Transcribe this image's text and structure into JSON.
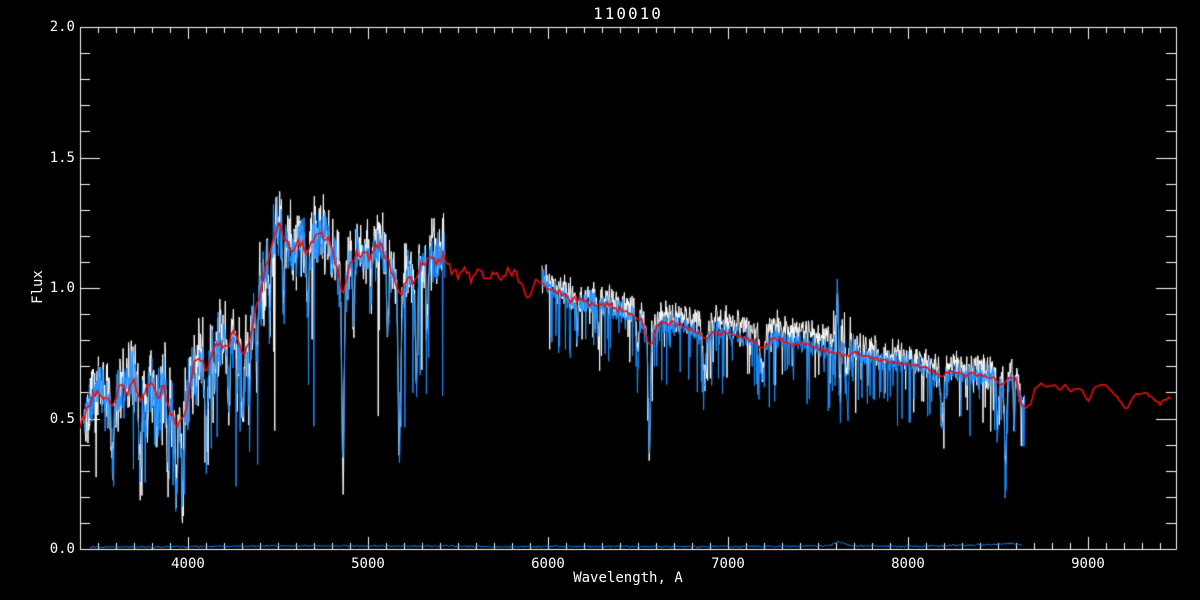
{
  "figure": {
    "background_color": "#000000",
    "axis_color": "#ffffff",
    "text_color": "#ffffff"
  },
  "chart_data": {
    "type": "line",
    "title": "110010",
    "xlabel": "Wavelength, A",
    "ylabel": "Flux",
    "xlim": [
      3400,
      9489
    ],
    "ylim": [
      0.0,
      2.0
    ],
    "xticks": [
      4000,
      5000,
      6000,
      7000,
      8000,
      9000
    ],
    "xtick_labels": [
      "4000",
      "5000",
      "6000",
      "7000",
      "8000",
      "9000"
    ],
    "x_minor_step": 100,
    "yticks": [
      0.0,
      0.5,
      1.0,
      1.5,
      2.0
    ],
    "ytick_labels": [
      "0.0",
      "0.5",
      "1.0",
      "1.5",
      "2.0"
    ],
    "y_minor_step": 0.1,
    "grid": false,
    "legend": null,
    "noise_seed": 1337,
    "series_meta": [
      {
        "name": "observed-spectrum-white",
        "color": "#ffffff",
        "role": "noisy-spectrum"
      },
      {
        "name": "observed-spectrum-blue",
        "color": "#1e90ff",
        "role": "noisy-spectrum"
      },
      {
        "name": "model-spectrum-red",
        "color": "#ee0d0d",
        "role": "model-curve"
      },
      {
        "name": "error-spectrum-blue",
        "color": "#1e90ff",
        "role": "error-near-zero"
      }
    ],
    "segments": [
      [
        3422,
        5428
      ],
      [
        5967,
        8648
      ]
    ],
    "red_range": [
      3400,
      9470
    ],
    "error_range": [
      3455,
      8635
    ],
    "continuum": [
      [
        3400,
        0.48
      ],
      [
        3450,
        0.55
      ],
      [
        3500,
        0.62
      ],
      [
        3540,
        0.57
      ],
      [
        3590,
        0.55
      ],
      [
        3620,
        0.63
      ],
      [
        3660,
        0.6
      ],
      [
        3700,
        0.66
      ],
      [
        3735,
        0.55
      ],
      [
        3770,
        0.63
      ],
      [
        3800,
        0.64
      ],
      [
        3835,
        0.57
      ],
      [
        3865,
        0.62
      ],
      [
        3900,
        0.52
      ],
      [
        3935,
        0.47
      ],
      [
        3970,
        0.5
      ],
      [
        4000,
        0.58
      ],
      [
        4040,
        0.71
      ],
      [
        4070,
        0.74
      ],
      [
        4102,
        0.66
      ],
      [
        4140,
        0.77
      ],
      [
        4180,
        0.8
      ],
      [
        4220,
        0.77
      ],
      [
        4260,
        0.84
      ],
      [
        4305,
        0.73
      ],
      [
        4345,
        0.82
      ],
      [
        4390,
        0.96
      ],
      [
        4430,
        1.06
      ],
      [
        4470,
        1.17
      ],
      [
        4500,
        1.26
      ],
      [
        4540,
        1.19
      ],
      [
        4580,
        1.14
      ],
      [
        4620,
        1.18
      ],
      [
        4660,
        1.13
      ],
      [
        4700,
        1.19
      ],
      [
        4740,
        1.22
      ],
      [
        4780,
        1.18
      ],
      [
        4820,
        1.11
      ],
      [
        4861,
        0.97
      ],
      [
        4900,
        1.08
      ],
      [
        4940,
        1.13
      ],
      [
        4980,
        1.14
      ],
      [
        5020,
        1.12
      ],
      [
        5060,
        1.17
      ],
      [
        5100,
        1.12
      ],
      [
        5140,
        1.05
      ],
      [
        5175,
        0.96
      ],
      [
        5215,
        1.05
      ],
      [
        5255,
        1.01
      ],
      [
        5300,
        1.09
      ],
      [
        5340,
        1.12
      ],
      [
        5380,
        1.1
      ],
      [
        5420,
        1.12
      ],
      [
        5460,
        1.08
      ],
      [
        5500,
        1.04
      ],
      [
        5540,
        1.08
      ],
      [
        5580,
        1.03
      ],
      [
        5620,
        1.07
      ],
      [
        5660,
        1.03
      ],
      [
        5700,
        1.06
      ],
      [
        5740,
        1.03
      ],
      [
        5780,
        1.07
      ],
      [
        5820,
        1.05
      ],
      [
        5860,
        1.01
      ],
      [
        5893,
        0.95
      ],
      [
        5930,
        1.03
      ],
      [
        5970,
        1.02
      ],
      [
        6020,
        1.0
      ],
      [
        6070,
        0.98
      ],
      [
        6120,
        0.96
      ],
      [
        6170,
        0.95
      ],
      [
        6220,
        0.945
      ],
      [
        6280,
        0.945
      ],
      [
        6340,
        0.93
      ],
      [
        6400,
        0.915
      ],
      [
        6460,
        0.9
      ],
      [
        6520,
        0.88
      ],
      [
        6563,
        0.77
      ],
      [
        6610,
        0.86
      ],
      [
        6660,
        0.87
      ],
      [
        6710,
        0.86
      ],
      [
        6760,
        0.85
      ],
      [
        6810,
        0.84
      ],
      [
        6870,
        0.8
      ],
      [
        6920,
        0.83
      ],
      [
        6970,
        0.83
      ],
      [
        7020,
        0.82
      ],
      [
        7080,
        0.81
      ],
      [
        7140,
        0.79
      ],
      [
        7190,
        0.77
      ],
      [
        7250,
        0.81
      ],
      [
        7310,
        0.8
      ],
      [
        7370,
        0.78
      ],
      [
        7430,
        0.79
      ],
      [
        7490,
        0.77
      ],
      [
        7550,
        0.76
      ],
      [
        7610,
        0.75
      ],
      [
        7660,
        0.74
      ],
      [
        7710,
        0.75
      ],
      [
        7770,
        0.74
      ],
      [
        7830,
        0.73
      ],
      [
        7890,
        0.72
      ],
      [
        7950,
        0.715
      ],
      [
        8010,
        0.71
      ],
      [
        8070,
        0.7
      ],
      [
        8130,
        0.68
      ],
      [
        8190,
        0.665
      ],
      [
        8250,
        0.68
      ],
      [
        8310,
        0.67
      ],
      [
        8370,
        0.67
      ],
      [
        8430,
        0.66
      ],
      [
        8470,
        0.66
      ],
      [
        8500,
        0.64
      ],
      [
        8530,
        0.63
      ],
      [
        8560,
        0.655
      ],
      [
        8600,
        0.655
      ],
      [
        8630,
        0.55
      ],
      [
        8655,
        0.54
      ],
      [
        8680,
        0.56
      ],
      [
        8710,
        0.62
      ],
      [
        8740,
        0.635
      ],
      [
        8780,
        0.62
      ],
      [
        8810,
        0.63
      ],
      [
        8840,
        0.61
      ],
      [
        8880,
        0.63
      ],
      [
        8910,
        0.6
      ],
      [
        8940,
        0.62
      ],
      [
        8970,
        0.6
      ],
      [
        9000,
        0.565
      ],
      [
        9040,
        0.62
      ],
      [
        9080,
        0.63
      ],
      [
        9120,
        0.61
      ],
      [
        9170,
        0.58
      ],
      [
        9210,
        0.535
      ],
      [
        9260,
        0.59
      ],
      [
        9310,
        0.6
      ],
      [
        9360,
        0.58
      ],
      [
        9400,
        0.56
      ],
      [
        9440,
        0.58
      ],
      [
        9470,
        0.57
      ]
    ],
    "absorption_lines": [
      [
        3580,
        0.35,
        8
      ],
      [
        3735,
        0.45,
        10
      ],
      [
        3770,
        0.3,
        8
      ],
      [
        3820,
        0.3,
        8
      ],
      [
        3889,
        0.4,
        8
      ],
      [
        3934,
        0.55,
        9
      ],
      [
        3969,
        0.5,
        9
      ],
      [
        4046,
        0.2,
        6
      ],
      [
        4102,
        0.45,
        9
      ],
      [
        4144,
        0.22,
        7
      ],
      [
        4227,
        0.38,
        7
      ],
      [
        4271,
        0.25,
        7
      ],
      [
        4305,
        0.35,
        10
      ],
      [
        4340,
        0.32,
        8
      ],
      [
        4383,
        0.28,
        7
      ],
      [
        4455,
        0.22,
        7
      ],
      [
        4531,
        0.22,
        8
      ],
      [
        4668,
        0.22,
        8
      ],
      [
        4861,
        0.65,
        9
      ],
      [
        4920,
        0.22,
        7
      ],
      [
        5015,
        0.2,
        7
      ],
      [
        5110,
        0.22,
        8
      ],
      [
        5175,
        0.6,
        11
      ],
      [
        5270,
        0.35,
        9
      ],
      [
        5328,
        0.25,
        8
      ],
      [
        6162,
        0.15,
        8
      ],
      [
        6280,
        0.15,
        8
      ],
      [
        6500,
        0.2,
        8
      ],
      [
        6563,
        0.57,
        7
      ],
      [
        6870,
        0.22,
        11
      ],
      [
        7190,
        0.15,
        14
      ],
      [
        8190,
        0.3,
        12
      ],
      [
        8498,
        0.28,
        7
      ],
      [
        8542,
        0.52,
        8
      ],
      [
        8590,
        0.3,
        6
      ]
    ],
    "noise_amp": [
      [
        3420,
        0.11
      ],
      [
        3600,
        0.14
      ],
      [
        3800,
        0.17
      ],
      [
        4000,
        0.17
      ],
      [
        4200,
        0.14
      ],
      [
        4400,
        0.15
      ],
      [
        4700,
        0.14
      ],
      [
        5000,
        0.13
      ],
      [
        5430,
        0.13
      ],
      [
        5967,
        0.055
      ],
      [
        6500,
        0.05
      ],
      [
        7000,
        0.05
      ],
      [
        7550,
        0.05
      ],
      [
        7700,
        0.05
      ],
      [
        8000,
        0.05
      ],
      [
        8650,
        0.055
      ]
    ],
    "white_offset": [
      [
        3400,
        0.0
      ],
      [
        5100,
        0.02
      ],
      [
        5430,
        0.04
      ],
      [
        5967,
        0.01
      ],
      [
        6100,
        0.02
      ],
      [
        6600,
        0.03
      ],
      [
        6900,
        0.04
      ],
      [
        7300,
        0.05
      ],
      [
        7620,
        0.05
      ],
      [
        7720,
        0.03
      ],
      [
        8200,
        0.02
      ],
      [
        8650,
        0.02
      ]
    ],
    "telluric_feature": {
      "range": [
        7585,
        7700
      ],
      "extra_noise": 0.1,
      "bumps": [
        [
          7608,
          0.3,
          5
        ],
        [
          7623,
          -0.2,
          5
        ],
        [
          7641,
          0.1,
          6
        ],
        [
          7662,
          -0.16,
          9
        ]
      ]
    },
    "red_jitter": [
      [
        3400,
        0.018
      ],
      [
        5430,
        0.02
      ],
      [
        5967,
        0.014
      ],
      [
        6800,
        0.01
      ],
      [
        8650,
        0.006
      ],
      [
        9470,
        0.007
      ]
    ],
    "error_level": [
      [
        3455,
        0.007
      ],
      [
        3800,
        0.008
      ],
      [
        4100,
        0.01
      ],
      [
        4500,
        0.012
      ],
      [
        5000,
        0.011
      ],
      [
        5430,
        0.012
      ],
      [
        5700,
        0.008
      ],
      [
        5967,
        0.01
      ],
      [
        6500,
        0.009
      ],
      [
        7000,
        0.009
      ],
      [
        7560,
        0.012
      ],
      [
        7615,
        0.028
      ],
      [
        7680,
        0.012
      ],
      [
        8000,
        0.01
      ],
      [
        8300,
        0.014
      ],
      [
        8500,
        0.018
      ],
      [
        8560,
        0.022
      ],
      [
        8635,
        0.015
      ]
    ]
  }
}
